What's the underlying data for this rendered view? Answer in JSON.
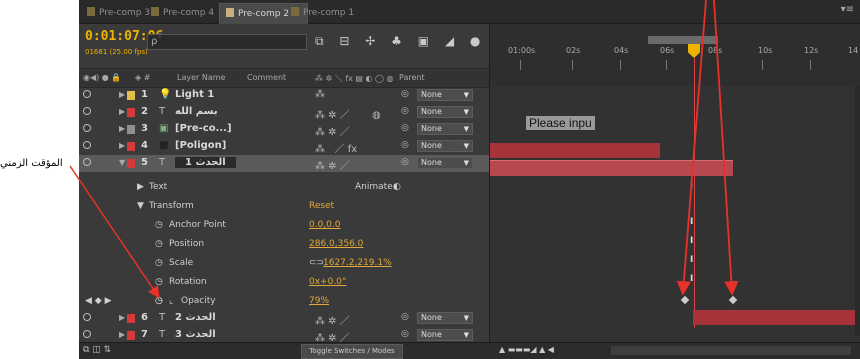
{
  "tabs": [
    {
      "label": "Pre-comp 3",
      "color": "#7b6a3e"
    },
    {
      "label": "Pre-comp 4",
      "color": "#7b6a3e"
    },
    {
      "label": "Pre-comp 2",
      "color": "#c7b07a",
      "close": "×"
    },
    {
      "label": "Pre-comp 1",
      "color": "#7b6a3e"
    }
  ],
  "timecode": "0:01:07:06",
  "fps": "01681 (25.00 fps)",
  "search": {
    "value": "ρ˙"
  },
  "columns": {
    "layer_name": "Layer Name",
    "comment": "Comment",
    "parent": "Parent"
  },
  "layers": [
    {
      "num": "1",
      "name": "Light 1",
      "icon": "light-bulb-icon",
      "color": "#e0c04a"
    },
    {
      "num": "2",
      "name": "بسم الله",
      "icon": "text-layer-icon",
      "color": "#d43a3a"
    },
    {
      "num": "3",
      "name": "[Pre-co...]",
      "icon": "precomp-icon",
      "color": "#8f8f8f"
    },
    {
      "num": "4",
      "name": "[Poligon]",
      "icon": "solid-icon",
      "color": "#d43a3a"
    },
    {
      "num": "5",
      "name": "الحدث 1",
      "icon": "text-layer-icon",
      "color": "#d43a3a"
    }
  ],
  "parent_value": "None",
  "properties": {
    "text": "Text",
    "animate": "Animate:",
    "transform": "Transform",
    "reset": "Reset",
    "anchor": {
      "label": "Anchor Point",
      "value": "0.0,0.0"
    },
    "position": {
      "label": "Position",
      "value": "286.0,356.0"
    },
    "scale": {
      "label": "Scale",
      "value": "1627.2,219.1%"
    },
    "rotation": {
      "label": "Rotation",
      "value": "0x+0.0°"
    },
    "opacity": {
      "label": "Opacity",
      "value": "79%"
    }
  },
  "layers_bottom": [
    {
      "num": "6",
      "name": "الحدث 2",
      "color": "#d43a3a"
    },
    {
      "num": "7",
      "name": "الحدث 3",
      "color": "#d43a3a"
    }
  ],
  "toggle_label": "Toggle Switches / Modes",
  "ruler_ticks": [
    "01:00s",
    "02s",
    "04s",
    "06s",
    "08s",
    "10s",
    "12s",
    "14"
  ],
  "timeline_text": "Please inpu",
  "annotation": "المؤقت الزمني",
  "colors": {
    "accent": "#f0b400",
    "bar_red": "#b8313a",
    "arrow": "#e8312a"
  }
}
